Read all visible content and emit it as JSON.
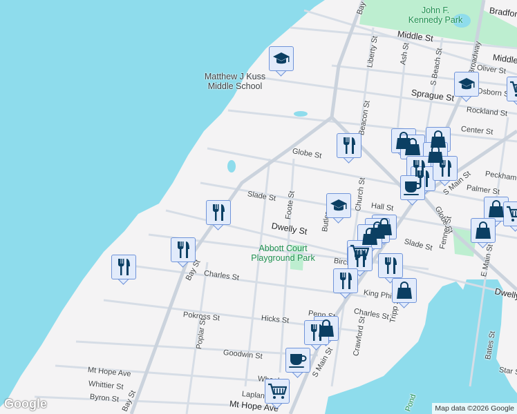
{
  "colors": {
    "water": "#8edcec",
    "land": "#f4f3f4",
    "park": "#bdeed0",
    "road": "#d6dde6",
    "marker_bg": "#e2ebfb",
    "marker_border": "#6f93d9",
    "icon": "#0b3f63"
  },
  "parks": {
    "kennedy": "John F. Kennedy Park",
    "abbott": "Abbott Court Playground Park"
  },
  "pois": {
    "school": "Matthew J Kuss Middle School"
  },
  "streets": {
    "bradford": "Bradford",
    "middle1": "Middle St",
    "middle2": "Middle",
    "liberty": "Liberty St",
    "ash": "Ash St",
    "sbeach": "S Beach St",
    "broadway": "Broadway",
    "oliver": "Oliver St",
    "osborn": "Osborn St",
    "sprague": "Sprague St",
    "rockland": "Rockland St",
    "center": "Center St",
    "beacon": "Beacon St",
    "globe1": "Globe St",
    "peckham": "Peckham",
    "smain1": "S Main St",
    "palmer": "Palmer St",
    "slade1": "Slade St",
    "foote": "Foote St",
    "church": "Church St",
    "hall": "Hall St",
    "globe2": "Globe St",
    "dwelly1": "Dwelly St",
    "butler": "Butler",
    "slade2": "Slade St",
    "fenner": "Fenner St",
    "emain": "E Main St",
    "birch": "Birch",
    "dwelly2": "Dwelly",
    "kingphilip": "King Philip St",
    "charles1": "Charles St",
    "charles2": "Charles St",
    "tripp": "Tripp St",
    "penn": "Penn St",
    "hicks": "Hicks St",
    "pokross": "Pokross St",
    "poplar": "Poplar St",
    "crawford": "Crawford St",
    "goodwin": "Goodwin St",
    "bates": "Bates St",
    "star": "Star St",
    "smain2": "S Main St",
    "mthope1": "Mt Hope Ave",
    "whittier": "Whittier St",
    "wheeler": "Wheeler",
    "byron": "Byron St",
    "laplante": "Laplante",
    "mthope2": "Mt Hope Ave",
    "bay1": "Bay St",
    "bay2": "Bay St",
    "bay3": "Bay",
    "pond": "Pond"
  },
  "markers": [
    "school",
    "school",
    "grocery",
    "restaurant",
    "shopping",
    "shopping",
    "shopping",
    "shopping",
    "restaurant",
    "restaurant",
    "restaurant",
    "coffee",
    "school",
    "shopping",
    "grocery",
    "shopping",
    "shopping",
    "shopping",
    "shopping",
    "grocery",
    "restaurant",
    "restaurant",
    "restaurant",
    "shopping",
    "restaurant",
    "restaurant",
    "restaurant",
    "shopping",
    "restaurant",
    "coffee",
    "grocery"
  ],
  "footer": {
    "logo": "Google",
    "attribution": "Map data ©2026 Google"
  }
}
